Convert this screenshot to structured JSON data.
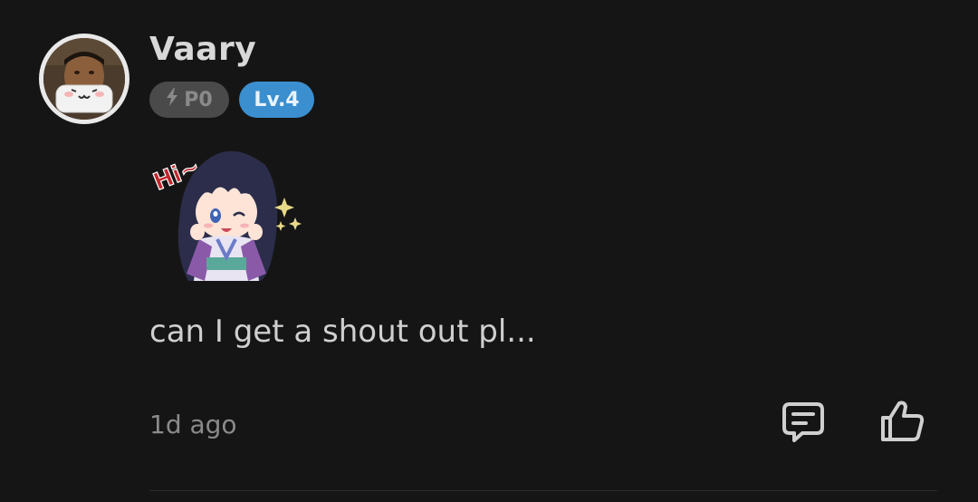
{
  "comment": {
    "username": "Vaary",
    "badges": {
      "points_label": "P0",
      "level_label": "Lv.4"
    },
    "sticker": {
      "text": "Hi~"
    },
    "message": "can I get a shout out pl...",
    "timestamp": "1d ago",
    "actions": {
      "reply_icon": "comment-reply-icon",
      "like_icon": "thumbs-up-icon"
    }
  },
  "colors": {
    "background": "#151515",
    "level_badge": "#3b8fcf",
    "points_badge": "#4a4a4a"
  }
}
